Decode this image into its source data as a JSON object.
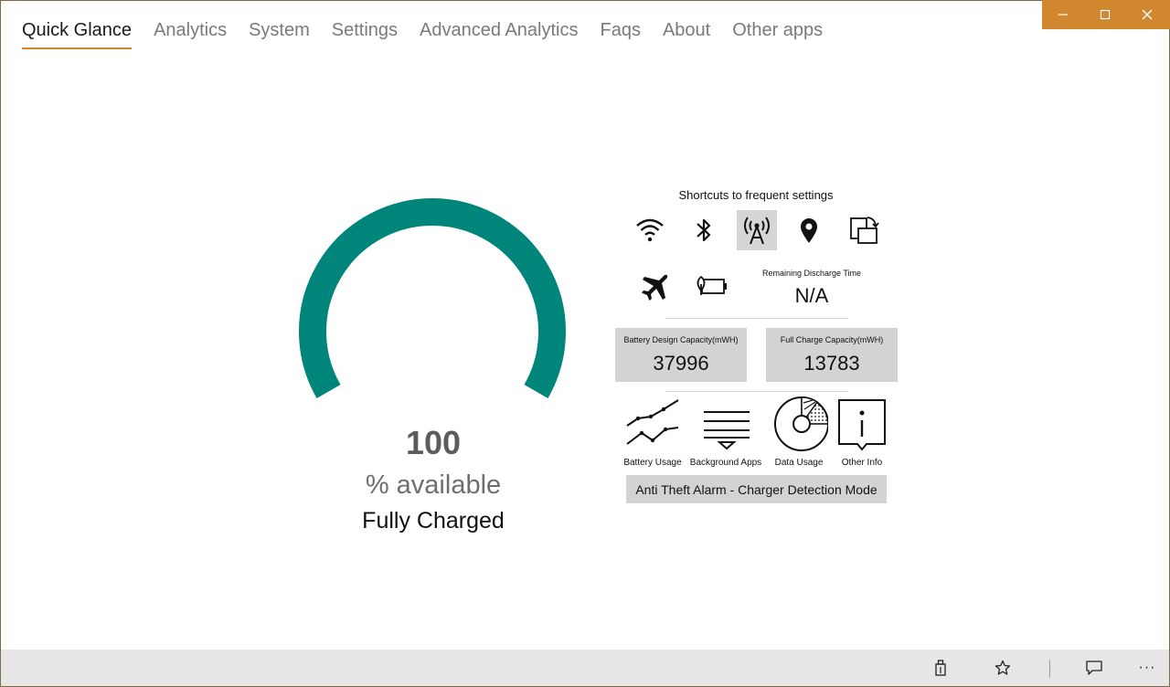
{
  "nav": {
    "tabs": [
      {
        "label": "Quick Glance",
        "active": true
      },
      {
        "label": "Analytics"
      },
      {
        "label": "System"
      },
      {
        "label": "Settings"
      },
      {
        "label": "Advanced Analytics"
      },
      {
        "label": "Faqs"
      },
      {
        "label": "About"
      },
      {
        "label": "Other apps"
      }
    ]
  },
  "window": {
    "accent": "#d1872e",
    "caption_icons": [
      "minimize-icon",
      "maximize-icon",
      "close-icon"
    ]
  },
  "gauge": {
    "value": "100",
    "percent": 100,
    "unit_label": "% available",
    "status": "Fully Charged",
    "color": "#00857a"
  },
  "shortcuts": {
    "title": "Shortcuts to frequent settings",
    "icons": [
      "wifi-icon",
      "bluetooth-icon",
      "cellular-antenna-icon",
      "location-icon",
      "rotation-lock-icon",
      "airplane-mode-icon",
      "battery-saver-icon"
    ],
    "selected": "cellular-antenna-icon"
  },
  "remaining": {
    "label": "Remaining Discharge Time",
    "value": "N/A"
  },
  "capacity": {
    "design_label": "Battery Design Capacity(mWH)",
    "design_value": "37996",
    "full_label": "Full Charge Capacity(mWH)",
    "full_value": "13783"
  },
  "features": {
    "battery_usage": "Battery Usage",
    "background_apps": "Background Apps",
    "data_usage": "Data Usage",
    "other_info": "Other Info"
  },
  "anti_theft": {
    "label": "Anti Theft Alarm - Charger Detection Mode"
  },
  "appbar": {
    "icons": [
      "pin-icon",
      "favorite-star-icon",
      "feedback-icon",
      "more-icon"
    ],
    "more_label": "···"
  }
}
